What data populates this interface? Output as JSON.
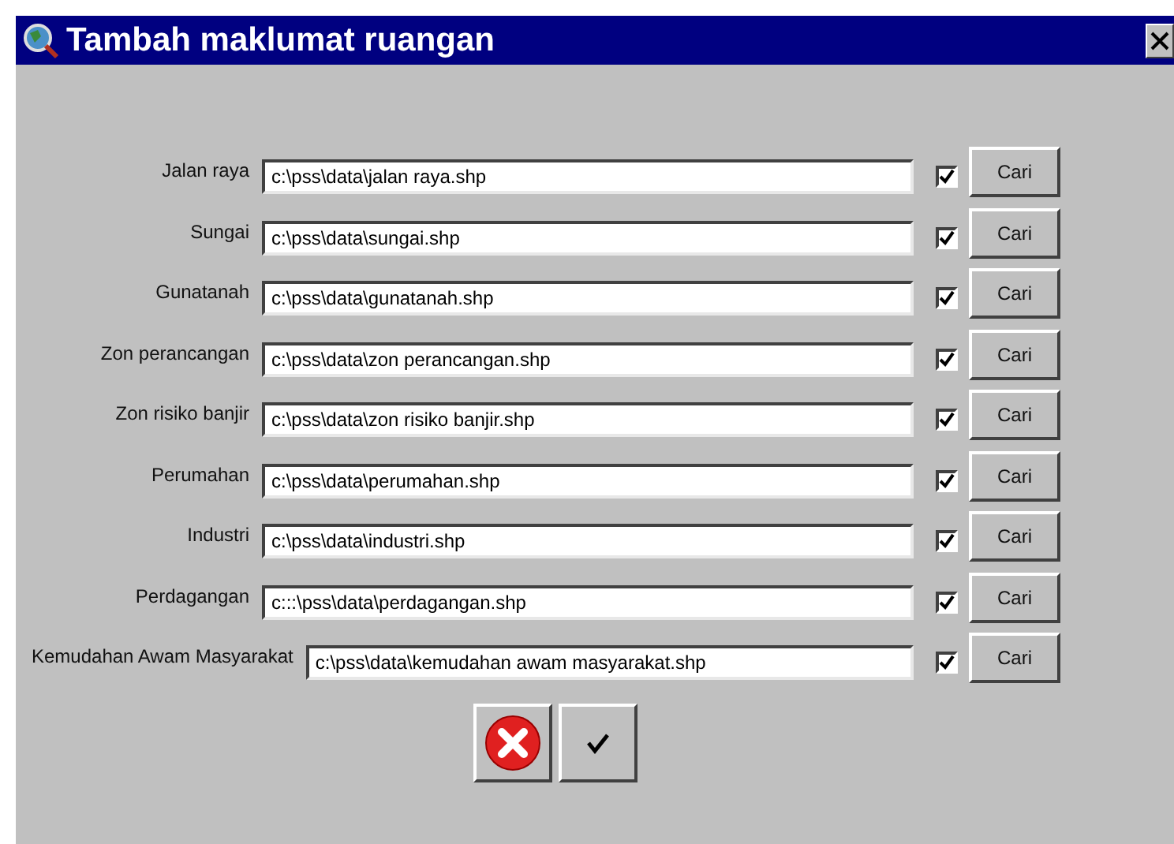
{
  "window": {
    "title": "Tambah maklumat ruangan"
  },
  "rows": [
    {
      "label": "Jalan raya",
      "value": "c:\\pss\\data\\jalan raya.shp",
      "checked": true,
      "button": "Cari"
    },
    {
      "label": "Sungai",
      "value": "c:\\pss\\data\\sungai.shp",
      "checked": true,
      "button": "Cari"
    },
    {
      "label": "Gunatanah",
      "value": "c:\\pss\\data\\gunatanah.shp",
      "checked": true,
      "button": "Cari"
    },
    {
      "label": "Zon perancangan",
      "value": "c:\\pss\\data\\zon perancangan.shp",
      "checked": true,
      "button": "Cari"
    },
    {
      "label": "Zon risiko banjir",
      "value": "c:\\pss\\data\\zon risiko banjir.shp",
      "checked": true,
      "button": "Cari"
    },
    {
      "label": "Perumahan",
      "value": "c:\\pss\\data\\perumahan.shp",
      "checked": true,
      "button": "Cari"
    },
    {
      "label": "Industri",
      "value": "c:\\pss\\data\\industri.shp",
      "checked": true,
      "button": "Cari"
    },
    {
      "label": "Perdagangan",
      "value": "c:::\\pss\\data\\perdagangan.shp",
      "checked": true,
      "button": "Cari"
    },
    {
      "label": "Kemudahan Awam Masyarakat",
      "value": "c:\\pss\\data\\kemudahan awam masyarakat.shp",
      "checked": true,
      "button": "Cari"
    }
  ]
}
